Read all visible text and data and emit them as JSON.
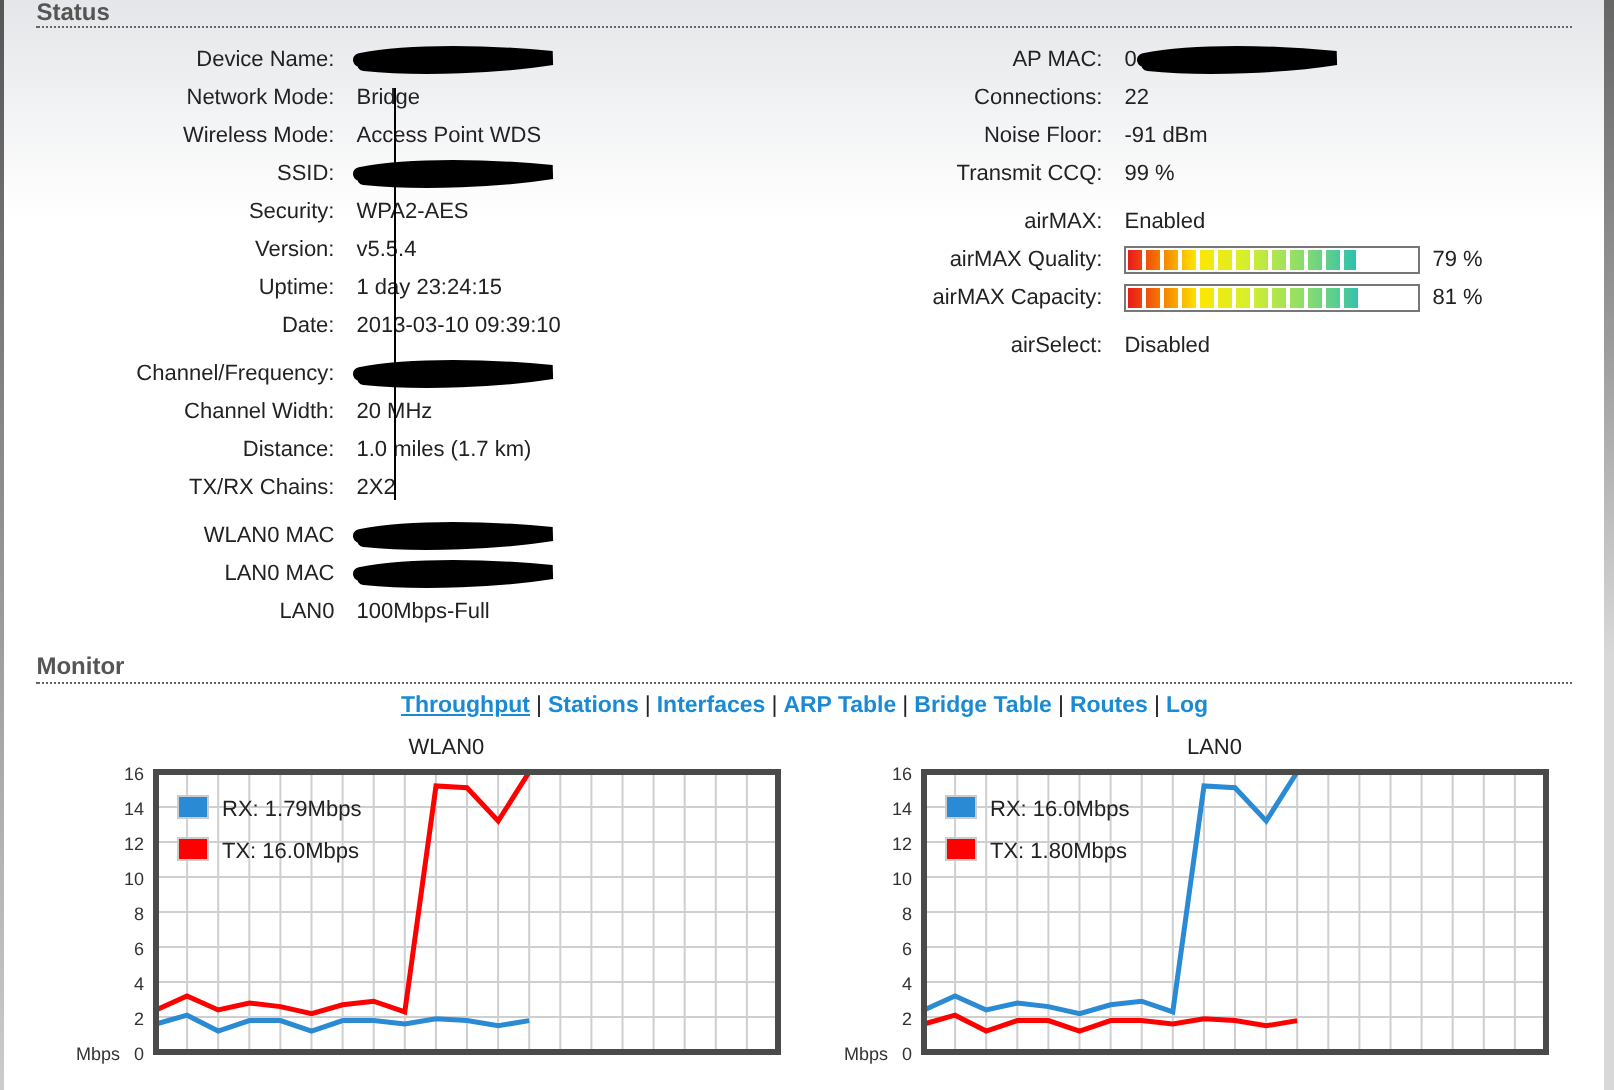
{
  "status": {
    "title": "Status",
    "left": [
      [
        {
          "label": "Device Name:",
          "redacted": true
        },
        {
          "label": "Network Mode:",
          "value": "Bridge"
        },
        {
          "label": "Wireless Mode:",
          "value": "Access Point WDS"
        },
        {
          "label": "SSID:",
          "redacted": true
        },
        {
          "label": "Security:",
          "value": "WPA2-AES"
        },
        {
          "label": "Version:",
          "value": "v5.5.4"
        },
        {
          "label": "Uptime:",
          "value": "1 day 23:24:15"
        },
        {
          "label": "Date:",
          "value": "2013-03-10 09:39:10"
        }
      ],
      [
        {
          "label": "Channel/Frequency:",
          "redacted": true
        },
        {
          "label": "Channel Width:",
          "value": "20 MHz"
        },
        {
          "label": "Distance:",
          "value": "1.0 miles (1.7 km)"
        },
        {
          "label": "TX/RX Chains:",
          "value": "2X2"
        }
      ],
      [
        {
          "label": "WLAN0 MAC",
          "redacted": true
        },
        {
          "label": "LAN0 MAC",
          "redacted": true
        },
        {
          "label": "LAN0",
          "value": "100Mbps-Full"
        }
      ]
    ],
    "right": [
      [
        {
          "label": "AP MAC:",
          "value": "0",
          "redacted": true
        },
        {
          "label": "Connections:",
          "value": "22"
        },
        {
          "label": "Noise Floor:",
          "value": "-91 dBm"
        },
        {
          "label": "Transmit CCQ:",
          "value": "99 %"
        }
      ],
      [
        {
          "label": "airMAX:",
          "value": "Enabled"
        },
        {
          "label": "airMAX Quality:",
          "kind": "meter",
          "level": 0.79,
          "reading": "79 %"
        },
        {
          "label": "airMAX Capacity:",
          "kind": "meter",
          "level": 0.81,
          "reading": "81 %"
        }
      ],
      [
        {
          "label": "airSelect:",
          "value": "Disabled"
        }
      ]
    ]
  },
  "monitor": {
    "title": "Monitor",
    "links": [
      {
        "label": "Throughput",
        "selected": true
      },
      {
        "label": "Stations",
        "selected": false
      },
      {
        "label": "Interfaces",
        "selected": false
      },
      {
        "label": "ARP Table",
        "selected": false
      },
      {
        "label": "Bridge Table",
        "selected": false
      },
      {
        "label": "Routes",
        "selected": false
      },
      {
        "label": "Log",
        "selected": false
      }
    ],
    "separator": "|",
    "charts": [
      {
        "chart_data": {
          "type": "line",
          "title": "WLAN0",
          "ylabel": "Mbps",
          "categories": [
            null,
            null,
            null,
            null,
            null,
            null,
            null,
            null,
            null,
            null,
            null,
            null,
            null
          ],
          "ylim": [
            0,
            16
          ],
          "yticks": [
            0,
            2,
            4,
            6,
            8,
            10,
            12,
            14,
            16
          ],
          "grid": true,
          "legend": true,
          "series": [
            {
              "name": "RX: 1.79Mbps",
              "color": "#2a8ad4",
              "values": [
                1.6,
                2.1,
                1.2,
                1.8,
                1.8,
                1.2,
                1.8,
                1.8,
                1.6,
                1.9,
                1.8,
                1.5,
                1.8
              ]
            },
            {
              "name": "TX: 16.0Mbps",
              "color": "#ff0000",
              "values": [
                2.4,
                3.2,
                2.4,
                2.8,
                2.6,
                2.2,
                2.7,
                2.9,
                2.3,
                15.2,
                15.1,
                13.2,
                16.0
              ]
            }
          ]
        }
      },
      {
        "chart_data": {
          "type": "line",
          "title": "LAN0",
          "ylabel": "Mbps",
          "categories": [
            null,
            null,
            null,
            null,
            null,
            null,
            null,
            null,
            null,
            null,
            null,
            null,
            null
          ],
          "ylim": [
            0,
            16
          ],
          "yticks": [
            0,
            2,
            4,
            6,
            8,
            10,
            12,
            14,
            16
          ],
          "grid": true,
          "legend": true,
          "series": [
            {
              "name": "RX: 16.0Mbps",
              "color": "#2a8ad4",
              "values": [
                2.4,
                3.2,
                2.4,
                2.8,
                2.6,
                2.2,
                2.7,
                2.9,
                2.3,
                15.2,
                15.1,
                13.2,
                16.0
              ]
            },
            {
              "name": "TX: 1.80Mbps",
              "color": "#ff0000",
              "values": [
                1.6,
                2.1,
                1.2,
                1.8,
                1.8,
                1.2,
                1.8,
                1.8,
                1.6,
                1.9,
                1.8,
                1.5,
                1.8
              ]
            }
          ]
        }
      }
    ]
  }
}
